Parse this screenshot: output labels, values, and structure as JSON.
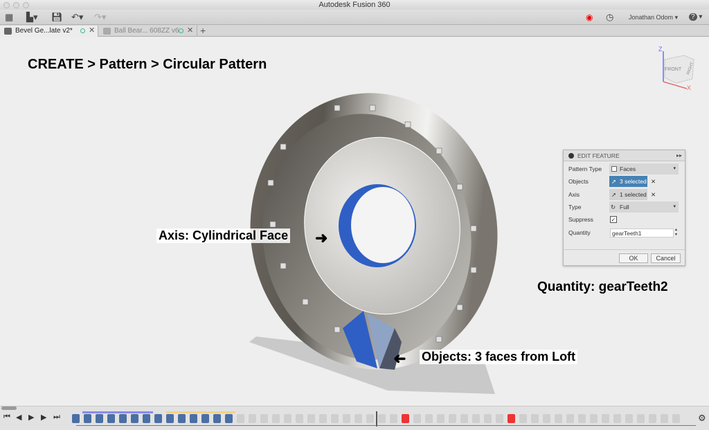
{
  "window": {
    "title": "Autodesk Fusion 360"
  },
  "toolbar": {
    "user": "Jonathan Odom",
    "user_caret": "▾",
    "help": "?",
    "help_caret": "▾"
  },
  "tabs": [
    {
      "label": "Bevel Ge...late v2*",
      "close": "✕"
    },
    {
      "label": "Ball Bear... 608ZZ v6",
      "close": "✕"
    }
  ],
  "new_tab": "+",
  "viewcube": {
    "z": "Z",
    "x": "X",
    "front": "FRONT",
    "right": "RIGHT"
  },
  "callouts": {
    "heading": "CREATE > Pattern > Circular Pattern",
    "axis": "Axis: Cylindrical Face",
    "quantity": "Quantity: gearTeeth2",
    "objects": "Objects: 3 faces from Loft"
  },
  "edit_feature": {
    "title": "EDIT FEATURE",
    "rows": [
      {
        "label": "Pattern Type",
        "value": "Faces"
      },
      {
        "label": "Objects",
        "value": "3 selected"
      },
      {
        "label": "Axis",
        "value": "1 selected"
      },
      {
        "label": "Type",
        "value": "Full"
      },
      {
        "label": "Suppress",
        "value": "✓"
      },
      {
        "label": "Quantity",
        "value": "gearTeeth1"
      }
    ],
    "clear": "✕",
    "ok": "OK",
    "cancel": "Cancel"
  },
  "timeline": {
    "features": [
      "body",
      "sketch",
      "extrude",
      "fillet",
      "sketch",
      "revolve",
      "pattern",
      "body",
      "sketch",
      "extrude",
      "fillet",
      "sketch",
      "revolve",
      "pattern",
      "body",
      "sketch",
      "link",
      "joint",
      "plane",
      "plane",
      "move",
      "joint",
      "sketch",
      "extrude",
      "fillet",
      "sketch",
      "revolve",
      "fillet",
      "pattern-error",
      "move",
      "body",
      "sketch",
      "extrude",
      "fillet",
      "sketch",
      "revolve",
      "fillet",
      "pattern-error",
      "sketch",
      "sketch",
      "body",
      "extrude",
      "joint",
      "plane",
      "plane",
      "move",
      "joint",
      "link",
      "sketch",
      "body",
      "extrude",
      "body"
    ],
    "marker_index": 26,
    "colors": {
      "active": "#4a6fa5",
      "suppressed": "#c8c8c8",
      "error": "#ee3333"
    }
  }
}
